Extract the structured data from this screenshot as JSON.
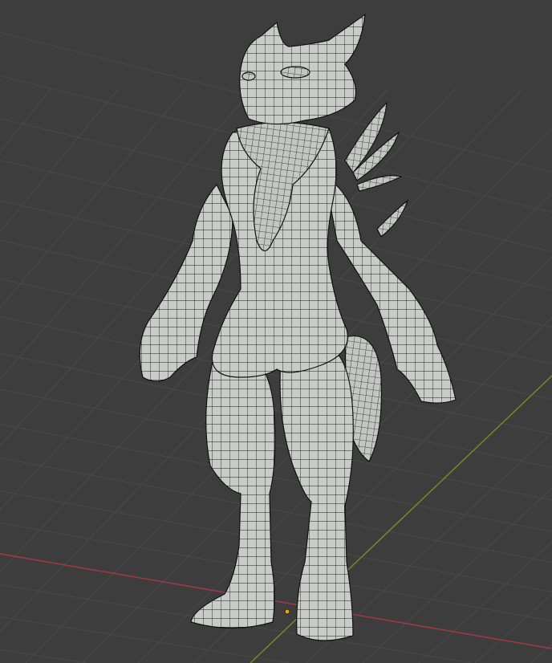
{
  "viewport": {
    "background_color": "#3d3d3d",
    "grid_color": "#4a4a4a",
    "x_axis_color": "#a23a45",
    "y_axis_color": "#6c8f22",
    "origin_color": "#f0a000",
    "mesh_fill_color": "#c9cbc9",
    "mesh_wire_color": "#1e1e1e"
  }
}
